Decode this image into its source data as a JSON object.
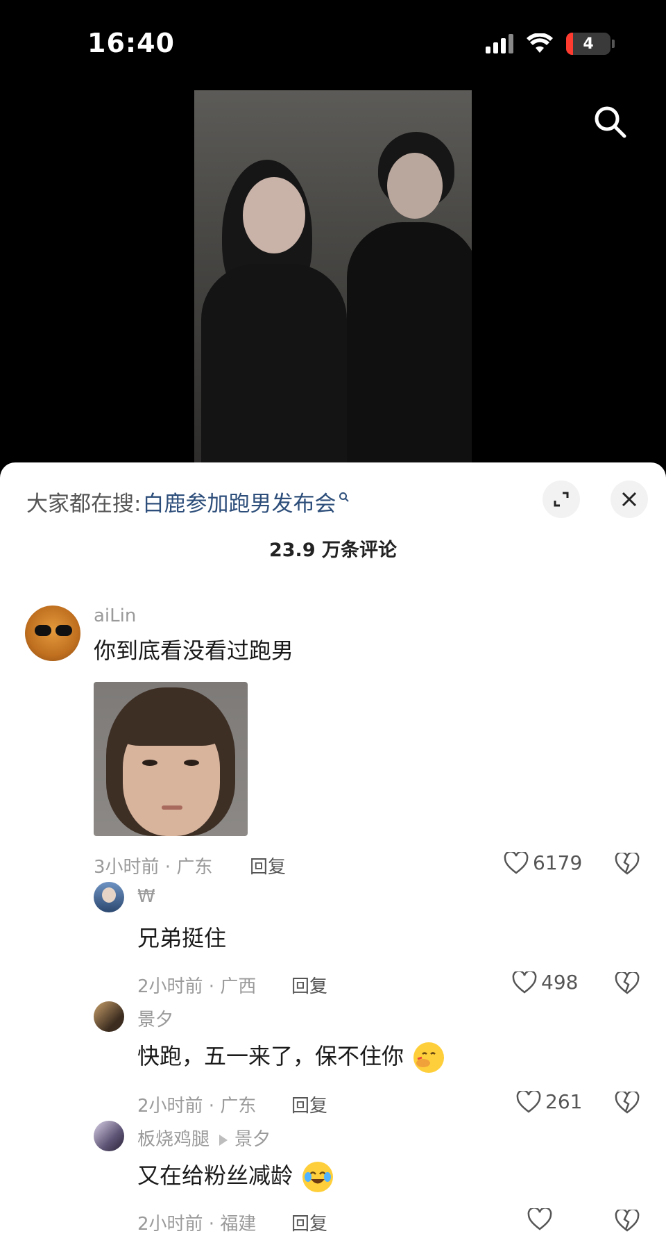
{
  "status_bar": {
    "time": "16:40",
    "battery_level": "4",
    "icons": [
      "signal-icon",
      "wifi-icon",
      "battery-icon"
    ]
  },
  "video": {
    "search_icon": "search-icon"
  },
  "sheet": {
    "trending_label": "大家都在搜:",
    "trending_query": "白鹿参加跑男发布会",
    "comment_count": "23.9 万条评论",
    "expand_icon": "expand-icon",
    "close_icon": "close-icon"
  },
  "comments": [
    {
      "username": "aiLin",
      "text": "你到底看没看过跑男",
      "meta": "3小时前 · 广东",
      "reply_label": "回复",
      "likes": "6179"
    },
    {
      "username": "₩",
      "text": "兄弟挺住",
      "meta": "2小时前 · 广西",
      "reply_label": "回复",
      "likes": "498"
    },
    {
      "username": "景夕",
      "text": "快跑，五一来了，保不住你",
      "meta": "2小时前 · 广东",
      "reply_label": "回复",
      "likes": "261"
    },
    {
      "username": "板烧鸡腿",
      "reply_to": "景夕",
      "text": "又在给粉丝减龄",
      "meta": "2小时前 · 福建",
      "reply_label": "回复"
    }
  ],
  "colors": {
    "link": "#2d4e7a",
    "meta_gray": "#9a9a9a",
    "battery_alert": "#ff3b30"
  }
}
